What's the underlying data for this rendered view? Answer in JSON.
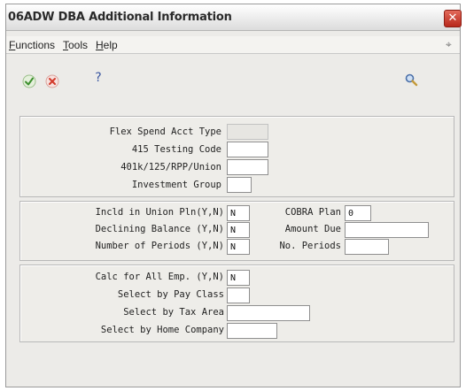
{
  "window": {
    "title": "06ADW DBA Additional Information",
    "close_glyph": "✕"
  },
  "menu": {
    "items": [
      "Functions",
      "Tools",
      "Help"
    ]
  },
  "toolbar": {
    "icons": [
      "checkmark-icon",
      "cancel-x-icon",
      "question-mark-icon",
      "magnifier-icon"
    ],
    "help_glyph": "?",
    "colors": {
      "ok": "#3d8f2e",
      "cancel": "#d23a2b",
      "help": "#3a56a0"
    }
  },
  "section1": {
    "flex_spend_label": "Flex Spend Acct Type",
    "flex_spend_value": "",
    "testing_code_label": "415 Testing Code",
    "testing_code_value": "",
    "plan_type_label": "401k/125/RPP/Union",
    "plan_type_value": "",
    "investment_group_label": "Investment Group",
    "investment_group_value": ""
  },
  "section2": {
    "union_label": "Incld in Union Pln(Y,N)",
    "union_value": "N",
    "declining_label": "Declining Balance (Y,N)",
    "declining_value": "N",
    "periods_yn_label": "Number of Periods (Y,N)",
    "periods_yn_value": "N",
    "cobra_label": "COBRA Plan",
    "cobra_value": "0",
    "amount_due_label": "Amount Due",
    "amount_due_value": "",
    "no_periods_label": "No. Periods",
    "no_periods_value": ""
  },
  "section3": {
    "calc_label": "Calc for All Emp. (Y,N)",
    "calc_value": "N",
    "pay_class_label": "Select by Pay Class",
    "pay_class_value": "",
    "tax_area_label": "Select by Tax Area",
    "tax_area_value": "",
    "home_company_label": "Select by Home Company",
    "home_company_value": ""
  }
}
